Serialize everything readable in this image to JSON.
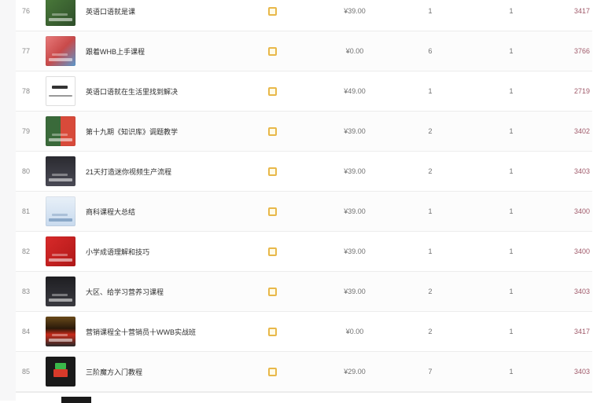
{
  "colors": {
    "checkbox_border": "#e8b84a",
    "code_text": "#a05a6a",
    "row_divider": "#ececec"
  },
  "rows": [
    {
      "num": "76",
      "title": "英语口语就是课",
      "price": "¥39.00",
      "a": "1",
      "b": "1",
      "code": "3417",
      "thumb": "t0"
    },
    {
      "num": "77",
      "title": "跟着WHB上手课程",
      "price": "¥0.00",
      "a": "6",
      "b": "1",
      "code": "3766",
      "thumb": "t1"
    },
    {
      "num": "78",
      "title": "英语口语就在生活里找到解决",
      "price": "¥49.00",
      "a": "1",
      "b": "1",
      "code": "2719",
      "thumb": "t2"
    },
    {
      "num": "79",
      "title": "第十九期《知识库》调题教学",
      "price": "¥39.00",
      "a": "2",
      "b": "1",
      "code": "3402",
      "thumb": "t3"
    },
    {
      "num": "80",
      "title": "21天打造迷你视频生产流程",
      "price": "¥39.00",
      "a": "2",
      "b": "1",
      "code": "3403",
      "thumb": "t4"
    },
    {
      "num": "81",
      "title": "商科课程大总结",
      "price": "¥39.00",
      "a": "1",
      "b": "1",
      "code": "3400",
      "thumb": "t5"
    },
    {
      "num": "82",
      "title": "小学成语理解和技巧",
      "price": "¥39.00",
      "a": "1",
      "b": "1",
      "code": "3400",
      "thumb": "t6"
    },
    {
      "num": "83",
      "title": "大区、给学习营养习课程",
      "price": "¥39.00",
      "a": "2",
      "b": "1",
      "code": "3403",
      "thumb": "t7"
    },
    {
      "num": "84",
      "title": "营销课程全十营销员十WWB实战班",
      "price": "¥0.00",
      "a": "2",
      "b": "1",
      "code": "3417",
      "thumb": "t8"
    },
    {
      "num": "85",
      "title": "三阶魔方入门教程",
      "price": "¥29.00",
      "a": "7",
      "b": "1",
      "code": "3403",
      "thumb": "t9"
    }
  ]
}
